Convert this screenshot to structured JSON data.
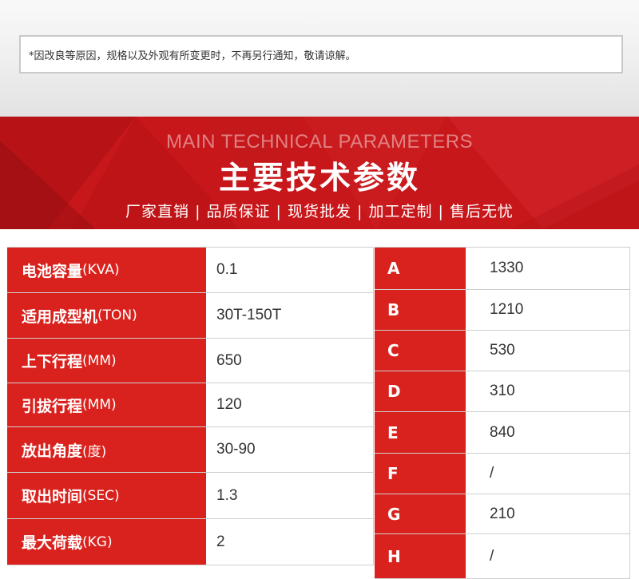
{
  "notice": {
    "text": "*因改良等原因，规格以及外观有所变更时，不再另行通知，敬请谅解。"
  },
  "banner": {
    "english_title": "MAIN TECHNICAL PARAMETERS",
    "title": "主要技术参数",
    "tagline": "厂家直销 | 品质保证 | 现货批发 | 加工定制 |  售后无忧"
  },
  "colors": {
    "brand_red": "#d9221d",
    "banner_red": "#c8171b",
    "text": "#333333"
  },
  "left_params": [
    {
      "name": "电池容量",
      "unit": "(KVA)",
      "value": "0.1"
    },
    {
      "name": "适用成型机",
      "unit": "(TON)",
      "value": "30T-150T"
    },
    {
      "name": "上下行程",
      "unit": "(MM)",
      "value": "650"
    },
    {
      "name": "引拔行程",
      "unit": "(MM)",
      "value": "120"
    },
    {
      "name": "放出角度",
      "unit": "(度)",
      "value": "30-90"
    },
    {
      "name": "取出时间",
      "unit": "(SEC)",
      "value": "1.3"
    },
    {
      "name": "最大荷载",
      "unit": "(KG)",
      "value": "2"
    }
  ],
  "right_params": [
    {
      "name": "A",
      "value": "1330"
    },
    {
      "name": "B",
      "value": "1210"
    },
    {
      "name": "C",
      "value": "530"
    },
    {
      "name": "D",
      "value": "310"
    },
    {
      "name": "E",
      "value": "840"
    },
    {
      "name": "F",
      "value": "/"
    },
    {
      "name": "G",
      "value": "210"
    },
    {
      "name": "H",
      "value": "/"
    }
  ]
}
